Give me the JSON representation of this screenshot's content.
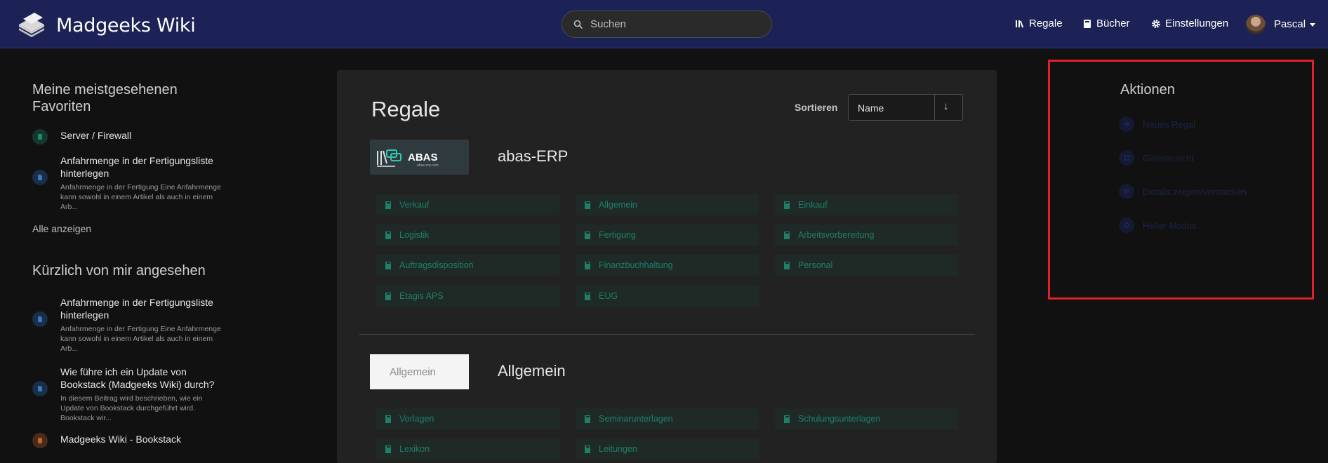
{
  "app": {
    "title": "Madgeeks Wiki"
  },
  "search": {
    "placeholder": "Suchen"
  },
  "nav": {
    "shelves": "Regale",
    "books": "Bücher",
    "settings": "Einstellungen",
    "user": "Pascal"
  },
  "sidebar": {
    "favorites_heading": "Meine meistgesehenen Favoriten",
    "favorites": [
      {
        "title": "Server / Firewall",
        "desc": ""
      },
      {
        "title": "Anfahrmenge in der Fertigungsliste hinterlegen",
        "desc": "Anfahrmenge in der Fertigung Eine Anfahrmenge kann sowohl in einem Artikel als auch in einem Arb..."
      }
    ],
    "show_all": "Alle anzeigen",
    "recent_heading": "Kürzlich von mir angesehen",
    "recent": [
      {
        "title": "Anfahrmenge in der Fertigungsliste hinterlegen",
        "desc": "Anfahrmenge in der Fertigung Eine Anfahrmenge kann sowohl in einem Artikel als auch in einem Arb..."
      },
      {
        "title": "Wie führe ich ein Update von Bookstack (Madgeeks Wiki) durch?",
        "desc": "In diesem Beitrag wird beschrieben, wie ein Update von Bookstack durchgeführt wird. Bookstack wir..."
      },
      {
        "title": "Madgeeks Wiki - Bookstack",
        "desc": ""
      }
    ]
  },
  "main": {
    "title": "Regale",
    "sort_label": "Sortieren",
    "sort_value": "Name",
    "sort_direction": "↓",
    "shelves": [
      {
        "name": "abas-ERP",
        "image_text": "ABAS",
        "image_subtext": "abas-erp.com",
        "books": [
          "Verkauf",
          "Allgemein",
          "Einkauf",
          "Logistik",
          "Fertigung",
          "Arbeitsvorbereitung",
          "Auftragsdisposition",
          "Finanzbuchhaltung",
          "Personal",
          "Etagis APS",
          "EUG"
        ]
      },
      {
        "name": "Allgemein",
        "image_text": "Allgemein",
        "books": [
          "Vorlagen",
          "Seminarunterlagen",
          "Schulungsunterlagen",
          "Lexikon",
          "Leitungen"
        ]
      }
    ]
  },
  "actions": {
    "title": "Aktionen",
    "items": [
      "Neues Regal",
      "Gitteransicht",
      "Details zeigen/verstecken",
      "Heller Modus"
    ]
  },
  "colors": {
    "header": "#1c2255",
    "background": "#111111",
    "panel": "#222222",
    "book_text": "#1e7e68",
    "highlight": "#e0202a"
  }
}
